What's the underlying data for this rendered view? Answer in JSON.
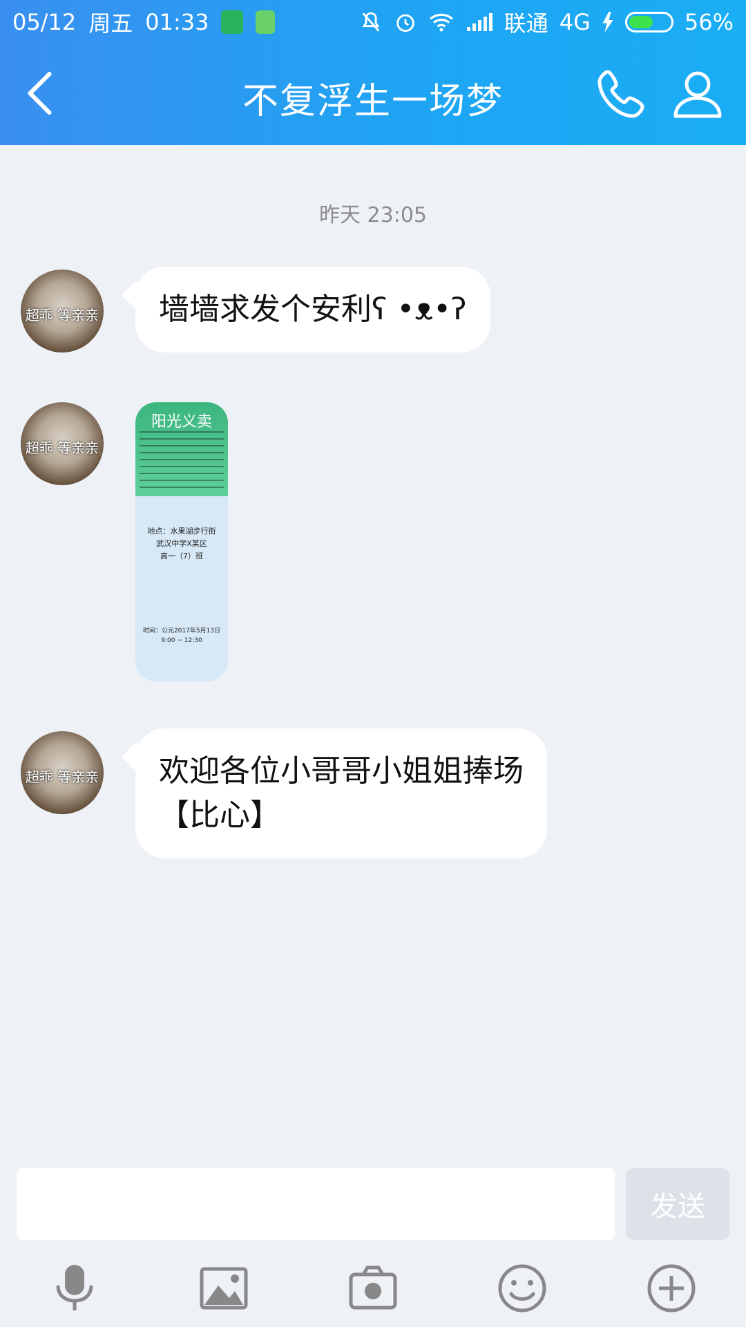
{
  "status_bar": {
    "date": "05/12",
    "weekday": "周五",
    "time": "01:33",
    "carrier": "联通",
    "network": "4G",
    "battery": "56%"
  },
  "header": {
    "title": "不复浮生一场梦"
  },
  "chat": {
    "timestamp": "昨天 23:05",
    "avatar_text": "超乖 等亲亲",
    "messages": [
      {
        "type": "text",
        "text": "墙墙求发个安利ʕ •ᴥ•ʔ"
      },
      {
        "type": "image",
        "image": {
          "title": "阳光义卖",
          "location_lines": [
            "地点：水果湖步行街",
            "武汉中学X某区",
            "高一（7）班"
          ],
          "time_lines": [
            "时间：公元2017年5月13日",
            "9:00 ~ 12:30"
          ]
        }
      },
      {
        "type": "text",
        "lines": [
          "欢迎各位小哥哥小姐姐捧场",
          "【比心】"
        ]
      }
    ]
  },
  "input": {
    "value": "",
    "send_label": "发送"
  },
  "colors": {
    "header_start": "#3a8ff0",
    "header_end": "#1aaef5",
    "chat_bg": "#eef1f6",
    "send_disabled": "#dde2e8"
  },
  "icons": [
    "back-arrow-icon",
    "phone-icon",
    "user-icon",
    "microphone-icon",
    "image-icon",
    "camera-icon",
    "emoji-icon",
    "plus-circle-icon"
  ]
}
